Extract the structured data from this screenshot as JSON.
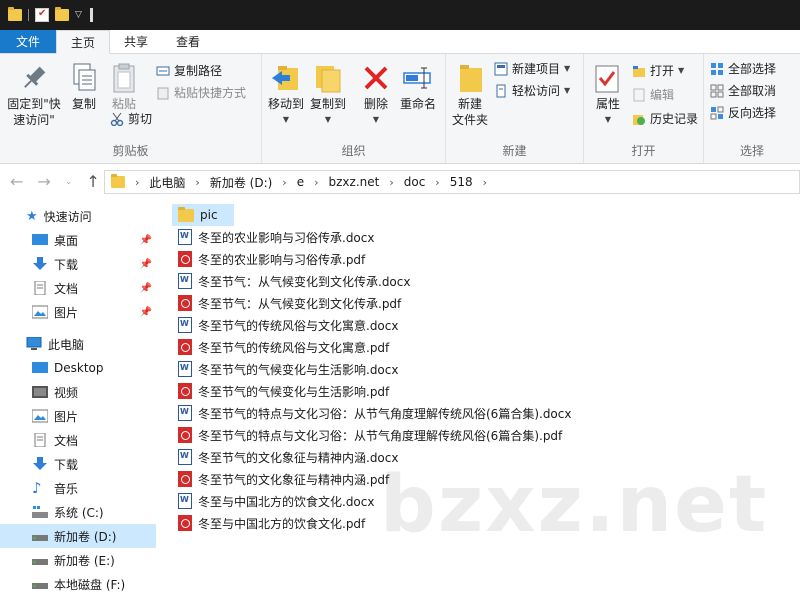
{
  "ribbon_tabs": [
    "文件",
    "主页",
    "共享",
    "查看"
  ],
  "ribbon": {
    "clipboard": {
      "label": "剪贴板",
      "pin": "固定到\"快\n速访问\"",
      "pin_l1": "固定到\"快",
      "pin_l2": "速访问\"",
      "copy": "复制",
      "paste": "粘贴",
      "copy_path": "复制路径",
      "paste_shortcut": "粘贴快捷方式",
      "cut": "剪切"
    },
    "organize": {
      "label": "组织",
      "move_to": "移动到",
      "copy_to": "复制到",
      "delete": "删除",
      "rename": "重命名"
    },
    "new": {
      "label": "新建",
      "new_folder_l1": "新建",
      "new_folder_l2": "文件夹",
      "new_item": "新建项目",
      "easy_access": "轻松访问"
    },
    "open": {
      "label": "打开",
      "properties": "属性",
      "open": "打开",
      "edit": "编辑",
      "history": "历史记录"
    },
    "select": {
      "label": "选择",
      "select_all": "全部选择",
      "select_none": "全部取消",
      "invert": "反向选择"
    }
  },
  "breadcrumb": [
    "此电脑",
    "新加卷 (D:)",
    "e",
    "bzxz.net",
    "doc",
    "518"
  ],
  "sidebar": {
    "quick_access": "快速访问",
    "quick_items": [
      "桌面",
      "下载",
      "文档",
      "图片"
    ],
    "this_pc": "此电脑",
    "pc_items": [
      "Desktop",
      "视频",
      "图片",
      "文档",
      "下载",
      "音乐",
      "系统 (C:)",
      "新加卷 (D:)",
      "新加卷 (E:)",
      "本地磁盘 (F:)"
    ]
  },
  "files": [
    {
      "name": "pic",
      "type": "folder"
    },
    {
      "name": "冬至的农业影响与习俗传承.docx",
      "type": "docx"
    },
    {
      "name": "冬至的农业影响与习俗传承.pdf",
      "type": "pdf"
    },
    {
      "name": "冬至节气：从气候变化到文化传承.docx",
      "type": "docx"
    },
    {
      "name": "冬至节气：从气候变化到文化传承.pdf",
      "type": "pdf"
    },
    {
      "name": "冬至节气的传统风俗与文化寓意.docx",
      "type": "docx"
    },
    {
      "name": "冬至节气的传统风俗与文化寓意.pdf",
      "type": "pdf"
    },
    {
      "name": "冬至节气的气候变化与生活影响.docx",
      "type": "docx"
    },
    {
      "name": "冬至节气的气候变化与生活影响.pdf",
      "type": "pdf"
    },
    {
      "name": "冬至节气的特点与文化习俗：从节气角度理解传统风俗(6篇合集).docx",
      "type": "docx"
    },
    {
      "name": "冬至节气的特点与文化习俗：从节气角度理解传统风俗(6篇合集).pdf",
      "type": "pdf"
    },
    {
      "name": "冬至节气的文化象征与精神内涵.docx",
      "type": "docx"
    },
    {
      "name": "冬至节气的文化象征与精神内涵.pdf",
      "type": "pdf"
    },
    {
      "name": "冬至与中国北方的饮食文化.docx",
      "type": "docx"
    },
    {
      "name": "冬至与中国北方的饮食文化.pdf",
      "type": "pdf"
    }
  ],
  "watermark": "bzxz.net"
}
